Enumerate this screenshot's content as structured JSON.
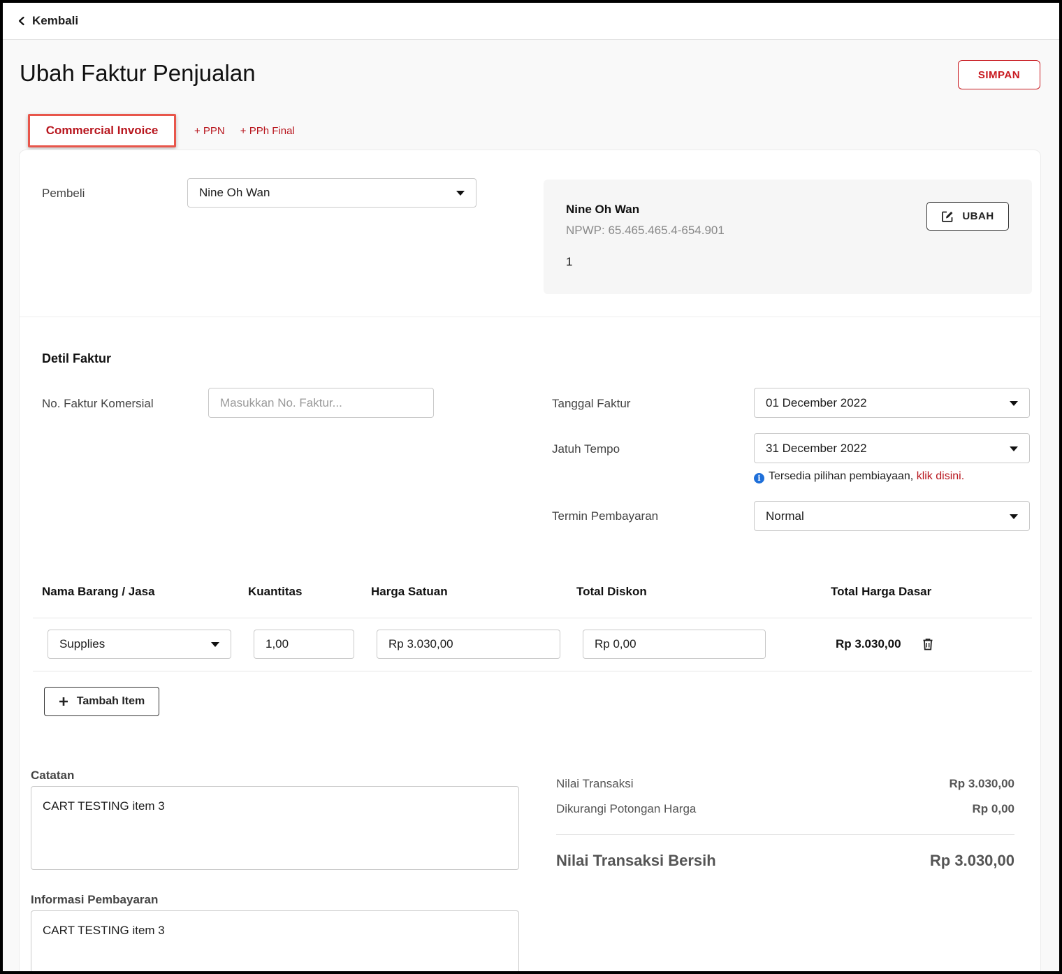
{
  "nav": {
    "back_label": "Kembali"
  },
  "header": {
    "title": "Ubah Faktur Penjualan",
    "save_label": "SIMPAN"
  },
  "tabs": {
    "active": "Commercial Invoice",
    "links": [
      "+ PPN",
      "+ PPh Final"
    ]
  },
  "buyer": {
    "label": "Pembeli",
    "selected": "Nine Oh Wan",
    "card_name": "Nine Oh Wan",
    "npwp": "NPWP: 65.465.465.4-654.901",
    "address": "1",
    "edit_label": "UBAH"
  },
  "details": {
    "title": "Detil Faktur",
    "invoice_no_label": "No. Faktur Komersial",
    "invoice_no_placeholder": "Masukkan No. Faktur...",
    "invoice_no_value": "",
    "date_label": "Tanggal Faktur",
    "date_value": "01 December 2022",
    "due_label": "Jatuh Tempo",
    "due_value": "31 December 2022",
    "financing_note": "Tersedia pilihan pembiayaan, ",
    "financing_link": "klik disini.",
    "terms_label": "Termin Pembayaran",
    "terms_value": "Normal"
  },
  "items": {
    "headers": [
      "Nama Barang / Jasa",
      "Kuantitas",
      "Harga Satuan",
      "Total Diskon",
      "Total Harga Dasar"
    ],
    "rows": [
      {
        "name": "Supplies",
        "qty": "1,00",
        "unit_price": "Rp 3.030,00",
        "discount": "Rp 0,00",
        "total": "Rp 3.030,00"
      }
    ],
    "add_label": "Tambah Item"
  },
  "notes": {
    "notes_label": "Catatan",
    "notes_value": "CART TESTING item 3",
    "payment_info_label": "Informasi Pembayaran",
    "payment_info_value": "CART TESTING item 3"
  },
  "summary": {
    "transaction_label": "Nilai Transaksi",
    "transaction_value": "Rp 3.030,00",
    "discount_label": "Dikurangi Potongan Harga",
    "discount_value": "Rp 0,00",
    "net_label": "Nilai Transaksi Bersih",
    "net_value": "Rp 3.030,00"
  },
  "colors": {
    "brand_red": "#c8191f",
    "info_blue": "#1e6fd9"
  }
}
